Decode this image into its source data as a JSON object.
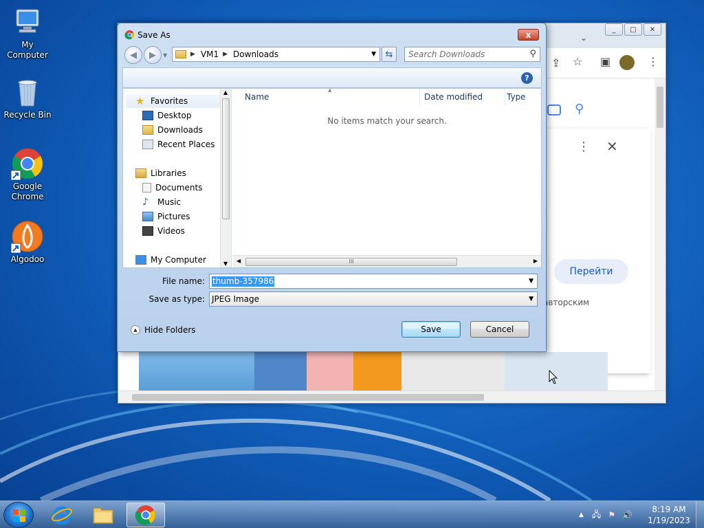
{
  "desktop": {
    "icons": [
      {
        "label": "My Computer"
      },
      {
        "label": "Recycle Bin"
      },
      {
        "label": "Google Chrome"
      },
      {
        "label": "Algodoo"
      }
    ]
  },
  "browser": {
    "go_button": "Перейти",
    "copyright_text": "авторским"
  },
  "dialog": {
    "title": "Save As",
    "close_label": "x",
    "address": {
      "root": "VM1",
      "folder": "Downloads"
    },
    "search_placeholder": "Search Downloads",
    "nav": {
      "favorites": "Favorites",
      "desktop": "Desktop",
      "downloads": "Downloads",
      "recent": "Recent Places",
      "libraries": "Libraries",
      "documents": "Documents",
      "music": "Music",
      "pictures": "Pictures",
      "videos": "Videos",
      "computer": "My Computer"
    },
    "columns": {
      "name": "Name",
      "date": "Date modified",
      "type": "Type"
    },
    "empty_message": "No items match your search.",
    "file_name_label": "File name:",
    "file_name_value": "thumb-357986",
    "save_type_label": "Save as type:",
    "save_type_value": "JPEG Image",
    "hide_folders": "Hide Folders",
    "save_button": "Save",
    "cancel_button": "Cancel"
  },
  "taskbar": {
    "time": "8:19 AM",
    "date": "1/19/2023"
  }
}
